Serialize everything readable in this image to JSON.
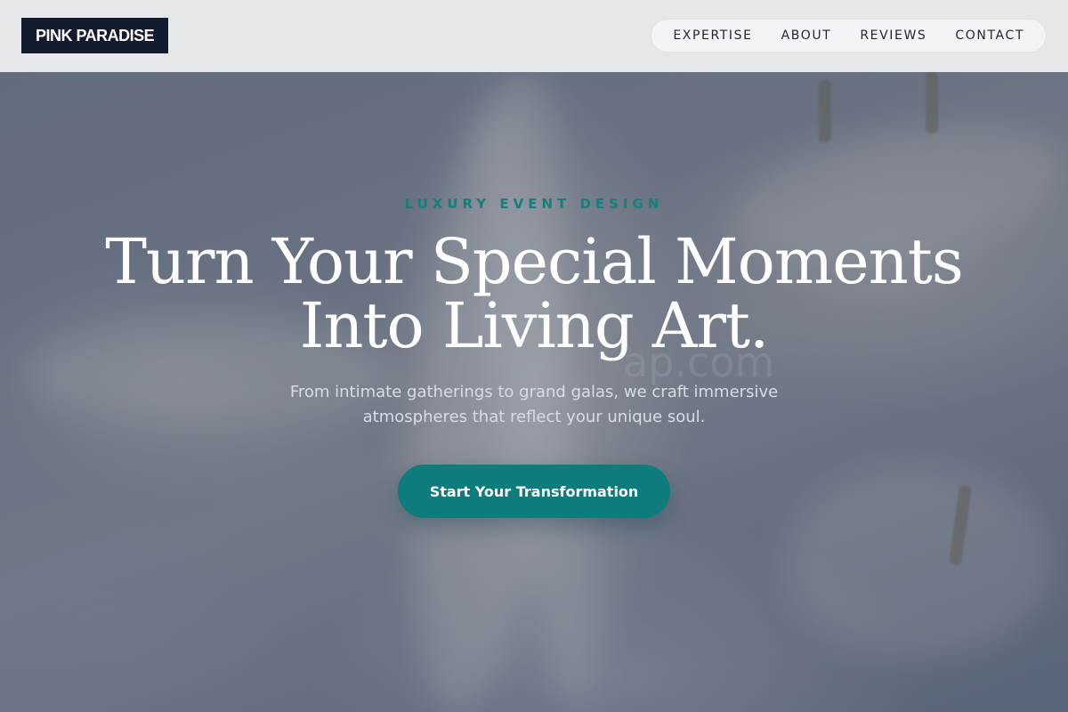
{
  "brand": {
    "logo_text": "PINK PARADISE"
  },
  "nav": {
    "items": [
      {
        "label": "EXPERTISE"
      },
      {
        "label": "ABOUT"
      },
      {
        "label": "REVIEWS"
      },
      {
        "label": "CONTACT"
      }
    ]
  },
  "hero": {
    "eyebrow": "LUXURY EVENT DESIGN",
    "headline_line1": "Turn Your Special Moments",
    "headline_line2": "Into Living Art.",
    "subtitle_line1": "From intimate gatherings to grand galas, we craft immersive",
    "subtitle_line2": "atmospheres that reflect your unique soul.",
    "cta_label": "Start Your Transformation",
    "watermark": "ap.com"
  },
  "colors": {
    "brand_dark": "#131b2e",
    "accent_teal": "#0d7c7d",
    "eyebrow_teal": "#14807e",
    "header_bg": "#eaecef"
  }
}
